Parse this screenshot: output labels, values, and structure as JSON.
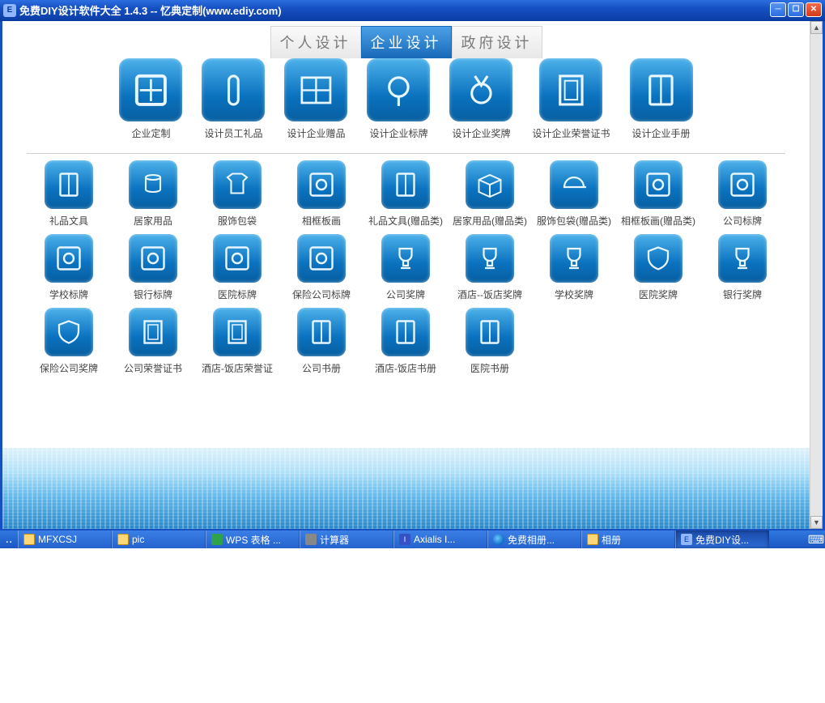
{
  "window": {
    "title": "免费DIY设计软件大全 1.4.3 -- 忆典定制(www.ediy.com)",
    "icon_letter": "E"
  },
  "tabs": [
    {
      "id": "personal",
      "label": "个人设计",
      "active": false
    },
    {
      "id": "enterprise",
      "label": "企业设计",
      "active": true
    },
    {
      "id": "government",
      "label": "政府设计",
      "active": false
    }
  ],
  "featured": [
    {
      "id": "qiye-dingzhi",
      "label": "企业定制",
      "icon": "stamp"
    },
    {
      "id": "yuangong-lipin",
      "label": "设计员工礼品",
      "icon": "bottle"
    },
    {
      "id": "zengpin",
      "label": "设计企业赠品",
      "icon": "shelf"
    },
    {
      "id": "biaopai",
      "label": "设计企业标牌",
      "icon": "sign"
    },
    {
      "id": "jiangpai",
      "label": "设计企业奖牌",
      "icon": "medal"
    },
    {
      "id": "zhengshu",
      "label": "设计企业荣誉证书",
      "icon": "cert"
    },
    {
      "id": "shouce",
      "label": "设计企业手册",
      "icon": "book"
    }
  ],
  "grid": [
    {
      "label": "礼品文具",
      "icon": "notebook"
    },
    {
      "label": "居家用品",
      "icon": "jar"
    },
    {
      "label": "服饰包袋",
      "icon": "shirt"
    },
    {
      "label": "相框板画",
      "icon": "frame"
    },
    {
      "label": "礼品文具(赠品类)",
      "icon": "notebook"
    },
    {
      "label": "居家用品(赠品类)",
      "icon": "box"
    },
    {
      "label": "服饰包袋(赠品类)",
      "icon": "cap"
    },
    {
      "label": "相框板画(赠品类)",
      "icon": "frame"
    },
    {
      "label": "公司标牌",
      "icon": "plaque-h"
    },
    {
      "label": "学校标牌",
      "icon": "plaque-v"
    },
    {
      "label": "银行标牌",
      "icon": "plaque-bank"
    },
    {
      "label": "医院标牌",
      "icon": "plaque-hang"
    },
    {
      "label": "保险公司标牌",
      "icon": "sign-wide"
    },
    {
      "label": "公司奖牌",
      "icon": "trophy"
    },
    {
      "label": "酒店--饭店奖牌",
      "icon": "cup"
    },
    {
      "label": "学校奖牌",
      "icon": "trophy2"
    },
    {
      "label": "医院奖牌",
      "icon": "shield"
    },
    {
      "label": "银行奖牌",
      "icon": "trophy3"
    },
    {
      "label": "保险公司奖牌",
      "icon": "shield2"
    },
    {
      "label": "公司荣誉证书",
      "icon": "cert2"
    },
    {
      "label": "酒店-饭店荣誉证",
      "icon": "cert3"
    },
    {
      "label": "公司书册",
      "icon": "book2"
    },
    {
      "label": "酒店-饭店书册",
      "icon": "book3"
    },
    {
      "label": "医院书册",
      "icon": "book4"
    }
  ],
  "taskbar": [
    {
      "label": "MFXCSJ",
      "icon": "folder",
      "active": false
    },
    {
      "label": "pic",
      "icon": "folder",
      "active": false
    },
    {
      "label": "WPS 表格 ...",
      "icon": "wps",
      "active": false
    },
    {
      "label": "计算器",
      "icon": "calc",
      "active": false
    },
    {
      "label": "Axialis I...",
      "icon": "ax",
      "active": false
    },
    {
      "label": "免费相册...",
      "icon": "ie",
      "active": false
    },
    {
      "label": "相册",
      "icon": "folder",
      "active": false
    },
    {
      "label": "免费DIY设...",
      "icon": "app",
      "active": true
    }
  ]
}
